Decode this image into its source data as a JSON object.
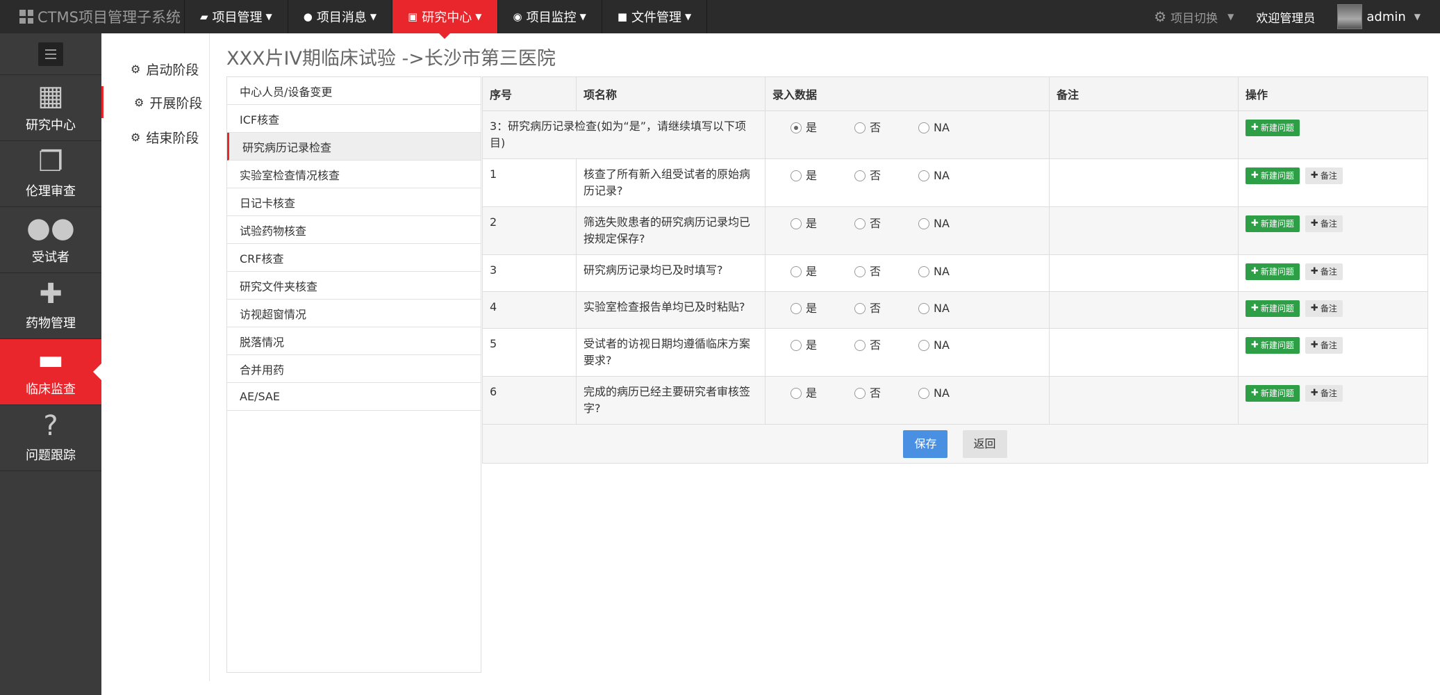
{
  "brand": {
    "title": "CTMS项目管理子系统"
  },
  "nav": [
    {
      "label": "项目管理",
      "icon": "book-icon"
    },
    {
      "label": "项目消息",
      "icon": "comments-icon"
    },
    {
      "label": "研究中心",
      "icon": "hospital-icon",
      "active": true
    },
    {
      "label": "项目监控",
      "icon": "eye-icon"
    },
    {
      "label": "文件管理",
      "icon": "folder-icon"
    }
  ],
  "topRight": {
    "switch_label": "项目切换",
    "welcome": "欢迎管理员",
    "username": "admin"
  },
  "sidebar": [
    {
      "label": "研究中心",
      "icon": "building-icon"
    },
    {
      "label": "伦理审查",
      "icon": "clone-icon"
    },
    {
      "label": "受试者",
      "icon": "users-icon"
    },
    {
      "label": "药物管理",
      "icon": "medkit-icon"
    },
    {
      "label": "临床监查",
      "icon": "bed-icon",
      "active": true
    },
    {
      "label": "问题跟踪",
      "icon": "question-icon"
    }
  ],
  "stages": [
    {
      "label": "启动阶段"
    },
    {
      "label": "开展阶段",
      "active": true
    },
    {
      "label": "结束阶段"
    }
  ],
  "pageTitle": "XXX片IV期临床试验 ->长沙市第三医院",
  "checkList": [
    "中心人员/设备变更",
    "ICF核查",
    "研究病历记录检查",
    "实验室检查情况核查",
    "日记卡核查",
    "试验药物核查",
    "CRF核查",
    "研究文件夹核查",
    "访视超窗情况",
    "脱落情况",
    "合并用药",
    "AE/SAE"
  ],
  "checkListActiveIndex": 2,
  "table": {
    "headers": {
      "no": "序号",
      "item": "项名称",
      "input": "录入数据",
      "remark": "备注",
      "op": "操作"
    },
    "header_row": {
      "text": "3：研究病历记录检查(如为“是”，请继续填写以下项目)",
      "selected": "是"
    },
    "options": [
      "是",
      "否",
      "NA"
    ],
    "rows": [
      {
        "no": "1",
        "item": "核查了所有新入组受试者的原始病历记录?"
      },
      {
        "no": "2",
        "item": "筛选失败患者的研究病历记录均已按规定保存?"
      },
      {
        "no": "3",
        "item": "研究病历记录均已及时填写?"
      },
      {
        "no": "4",
        "item": "实验室检查报告单均已及时粘贴?"
      },
      {
        "no": "5",
        "item": "受试者的访视日期均遵循临床方案要求?"
      },
      {
        "no": "6",
        "item": "完成的病历已经主要研究者审核签字?"
      }
    ],
    "btn_new_issue": "新建问题",
    "btn_remark": "备注"
  },
  "buttons": {
    "save": "保存",
    "back": "返回"
  },
  "colors": {
    "accent": "#e8262b",
    "green": "#2e9e47",
    "blue": "#4a90e2",
    "topbar": "#2b2b2b",
    "sidebar": "#3b3b3b"
  }
}
